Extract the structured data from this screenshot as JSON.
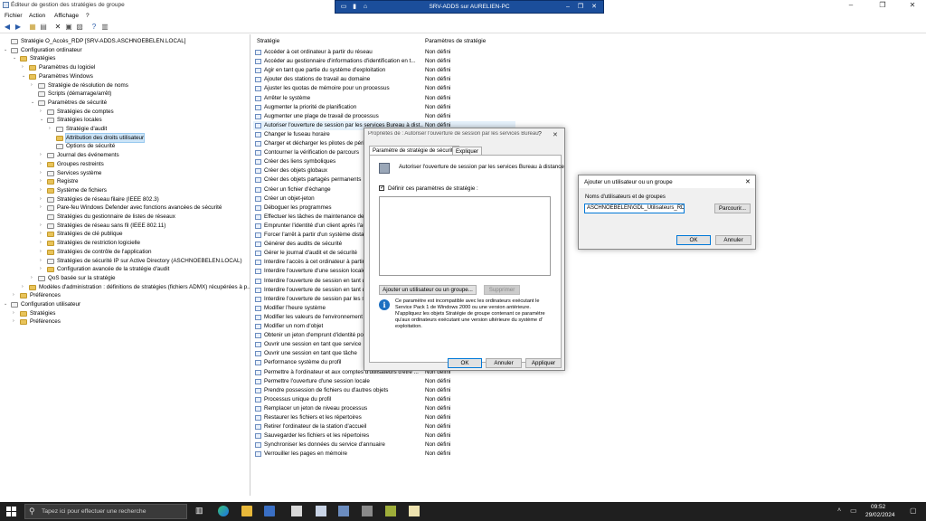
{
  "window": {
    "title": "Éditeur de gestion des stratégies de groupe"
  },
  "rdp": {
    "title": "SRV-ADDS sur AURELIEN-PC"
  },
  "menu": [
    "Fichier",
    "Action",
    "Affichage",
    "?"
  ],
  "tree": [
    {
      "t": "Stratégie O_Accès_RDP [SRV-ADDS.ASCHNOEBELEN.LOCAL]",
      "l": 0,
      "e": "",
      "i": "doc"
    },
    {
      "t": "Configuration ordinateur",
      "l": 0,
      "e": "v",
      "i": "pc"
    },
    {
      "t": "Stratégies",
      "l": 1,
      "e": "v",
      "i": "f"
    },
    {
      "t": "Paramètres du logiciel",
      "l": 2,
      "e": ">",
      "i": "f"
    },
    {
      "t": "Paramètres Windows",
      "l": 2,
      "e": "v",
      "i": "f"
    },
    {
      "t": "Stratégie de résolution de noms",
      "l": 3,
      "e": ">",
      "i": "doc"
    },
    {
      "t": "Scripts (démarrage/arrêt)",
      "l": 3,
      "e": "",
      "i": "doc"
    },
    {
      "t": "Paramètres de sécurité",
      "l": 3,
      "e": "v",
      "i": "doc"
    },
    {
      "t": "Stratégies de comptes",
      "l": 4,
      "e": ">",
      "i": "doc"
    },
    {
      "t": "Stratégies locales",
      "l": 4,
      "e": "v",
      "i": "doc"
    },
    {
      "t": "Stratégie d'audit",
      "l": 5,
      "e": ">",
      "i": "doc"
    },
    {
      "t": "Attribution des droits utilisateur",
      "l": 5,
      "e": "",
      "i": "f",
      "sel": true
    },
    {
      "t": "Options de sécurité",
      "l": 5,
      "e": "",
      "i": "doc"
    },
    {
      "t": "Journal des événements",
      "l": 4,
      "e": ">",
      "i": "doc"
    },
    {
      "t": "Groupes restreints",
      "l": 4,
      "e": ">",
      "i": "f"
    },
    {
      "t": "Services système",
      "l": 4,
      "e": ">",
      "i": "doc"
    },
    {
      "t": "Registre",
      "l": 4,
      "e": ">",
      "i": "f"
    },
    {
      "t": "Système de fichiers",
      "l": 4,
      "e": ">",
      "i": "f"
    },
    {
      "t": "Stratégies de réseau filaire (IEEE 802.3)",
      "l": 4,
      "e": ">",
      "i": "doc"
    },
    {
      "t": "Pare-feu Windows Defender avec fonctions avancées de sécurité",
      "l": 4,
      "e": ">",
      "i": "doc"
    },
    {
      "t": "Stratégies du gestionnaire de listes de réseaux",
      "l": 4,
      "e": "",
      "i": "doc"
    },
    {
      "t": "Stratégies de réseau sans fil (IEEE 802.11)",
      "l": 4,
      "e": ">",
      "i": "doc"
    },
    {
      "t": "Stratégies de clé publique",
      "l": 4,
      "e": ">",
      "i": "f"
    },
    {
      "t": "Stratégies de restriction logicielle",
      "l": 4,
      "e": ">",
      "i": "f"
    },
    {
      "t": "Stratégies de contrôle de l'application",
      "l": 4,
      "e": ">",
      "i": "f"
    },
    {
      "t": "Stratégies de sécurité IP sur Active Directory (ASCHNOEBELEN.LOCAL)",
      "l": 4,
      "e": ">",
      "i": "doc"
    },
    {
      "t": "Configuration avancée de la stratégie d'audit",
      "l": 4,
      "e": ">",
      "i": "f"
    },
    {
      "t": "QoS basée sur la stratégie",
      "l": 3,
      "e": ">",
      "i": "doc"
    },
    {
      "t": "Modèles d'administration : définitions de stratégies (fichiers ADMX) récupérées à p...",
      "l": 2,
      "e": ">",
      "i": "f"
    },
    {
      "t": "Préférences",
      "l": 1,
      "e": ">",
      "i": "f"
    },
    {
      "t": "Configuration utilisateur",
      "l": 0,
      "e": "v",
      "i": "pc"
    },
    {
      "t": "Stratégies",
      "l": 1,
      "e": ">",
      "i": "f"
    },
    {
      "t": "Préférences",
      "l": 1,
      "e": ">",
      "i": "f"
    }
  ],
  "list": {
    "col_policy": "Stratégie",
    "col_setting": "Paramètres de stratégie",
    "rows": [
      {
        "n": "Accéder à cet ordinateur à partir du réseau",
        "v": "Non défini"
      },
      {
        "n": "Accéder au gestionnaire d'informations d'identification en t...",
        "v": "Non défini"
      },
      {
        "n": "Agir en tant que partie du système d'exploitation",
        "v": "Non défini"
      },
      {
        "n": "Ajouter des stations de travail au domaine",
        "v": "Non défini"
      },
      {
        "n": "Ajuster les quotas de mémoire pour un processus",
        "v": "Non défini"
      },
      {
        "n": "Arrêter le système",
        "v": "Non défini"
      },
      {
        "n": "Augmenter la priorité de planification",
        "v": "Non défini"
      },
      {
        "n": "Augmenter une plage de travail de processus",
        "v": "Non défini"
      },
      {
        "n": "Autoriser l'ouverture de session par les services Bureau à dist...",
        "v": "Non défini",
        "sel": true
      },
      {
        "n": "Changer le fuseau horaire",
        "v": "Non défini"
      },
      {
        "n": "Charger et décharger les pilotes de périphériques",
        "v": "Non défini"
      },
      {
        "n": "Contourner la vérification de parcours",
        "v": "Non défini"
      },
      {
        "n": "Créer des liens symboliques",
        "v": "Non défini"
      },
      {
        "n": "Créer des objets globaux",
        "v": "Non défini"
      },
      {
        "n": "Créer des objets partagés permanents",
        "v": "Non défini"
      },
      {
        "n": "Créer un fichier d'échange",
        "v": "Non défini"
      },
      {
        "n": "Créer un objet-jeton",
        "v": "Non défini"
      },
      {
        "n": "Déboguer les programmes",
        "v": "Non défini"
      },
      {
        "n": "Effectuer les tâches de maintenance de volume",
        "v": "Non défini"
      },
      {
        "n": "Emprunter l'identité d'un client après l'authentification",
        "v": "Non défini"
      },
      {
        "n": "Forcer l'arrêt à partir d'un système distant",
        "v": "Non défini"
      },
      {
        "n": "Générer des audits de sécurité",
        "v": "Non défini"
      },
      {
        "n": "Gérer le journal d'audit et de sécurité",
        "v": "Non défini"
      },
      {
        "n": "Interdire l'accès à cet ordinateur à partir du réseau",
        "v": "Non défini"
      },
      {
        "n": "Interdire l'ouverture d'une session locale",
        "v": "Non défini"
      },
      {
        "n": "Interdire l'ouverture de session en tant que tâche",
        "v": "Non défini"
      },
      {
        "n": "Interdire l'ouverture de session en tant que service",
        "v": "Non défini"
      },
      {
        "n": "Interdire l'ouverture de session par les services Bureau",
        "v": "Non défini"
      },
      {
        "n": "Modifier l'heure système",
        "v": "Non défini"
      },
      {
        "n": "Modifier les valeurs de l'environnement",
        "v": "Non défini"
      },
      {
        "n": "Modifier un nom d'objet",
        "v": "Non défini"
      },
      {
        "n": "Obtenir un jeton d'emprunt d'identité pour",
        "v": "Non défini"
      },
      {
        "n": "Ouvrir une session en tant que service",
        "v": "Non défini"
      },
      {
        "n": "Ouvrir une session en tant que tâche",
        "v": "Non défini"
      },
      {
        "n": "Performance système du profil",
        "v": "Non défini"
      },
      {
        "n": "Permettre à l'ordinateur et aux comptes d'utilisateurs d'être ...",
        "v": "Non défini"
      },
      {
        "n": "Permettre l'ouverture d'une session locale",
        "v": "Non défini"
      },
      {
        "n": "Prendre possession de fichiers ou d'autres objets",
        "v": "Non défini"
      },
      {
        "n": "Processus unique du profil",
        "v": "Non défini"
      },
      {
        "n": "Remplacer un jeton de niveau processus",
        "v": "Non défini"
      },
      {
        "n": "Restaurer les fichiers et les répertoires",
        "v": "Non défini"
      },
      {
        "n": "Retirer l'ordinateur de la station d'accueil",
        "v": "Non défini"
      },
      {
        "n": "Sauvegarder les fichiers et les répertoires",
        "v": "Non défini"
      },
      {
        "n": "Synchroniser les données du service d'annuaire",
        "v": "Non défini"
      },
      {
        "n": "Verrouiller les pages en mémoire",
        "v": "Non défini"
      }
    ]
  },
  "prop": {
    "title": "Propriétés de : Autoriser l'ouverture de session par les services Bureau à distance",
    "help": "?",
    "close": "✕",
    "tab1": "Paramètre de stratégie de sécurité",
    "tab2": "Expliquer",
    "policy_name": "Autoriser l'ouverture de session par les services Bureau à distance",
    "define_label": "Définir ces paramètres de stratégie :",
    "add_btn": "Ajouter un utilisateur ou un groupe...",
    "remove_btn": "Supprimer",
    "info_l1": "Ce paramètre est incompatible avec les ordinateurs exécutant le",
    "info_l2": "Service Pack 1 de Windows 2000 ou une version antérieure.",
    "info_l3": "N'appliquez les objets Stratégie de groupe contenant ce paramètre",
    "info_l4": "qu'aux ordinateurs exécutant une version ultérieure du système d'",
    "info_l5": "exploitation.",
    "ok": "OK",
    "cancel": "Annuler",
    "apply": "Appliquer"
  },
  "add": {
    "title": "Ajouter un utilisateur ou un groupe",
    "close": "✕",
    "label": "Noms d'utilisateurs et de groupes",
    "value": "ASCHNOEBELEN\\GDL_Utilisateurs_RDP",
    "browse": "Parcourir...",
    "ok": "OK",
    "cancel": "Annuler"
  },
  "taskbar": {
    "search_placeholder": "Tapez ici pour effectuer une recherche",
    "time": "09:52",
    "date": "29/02/2024"
  }
}
